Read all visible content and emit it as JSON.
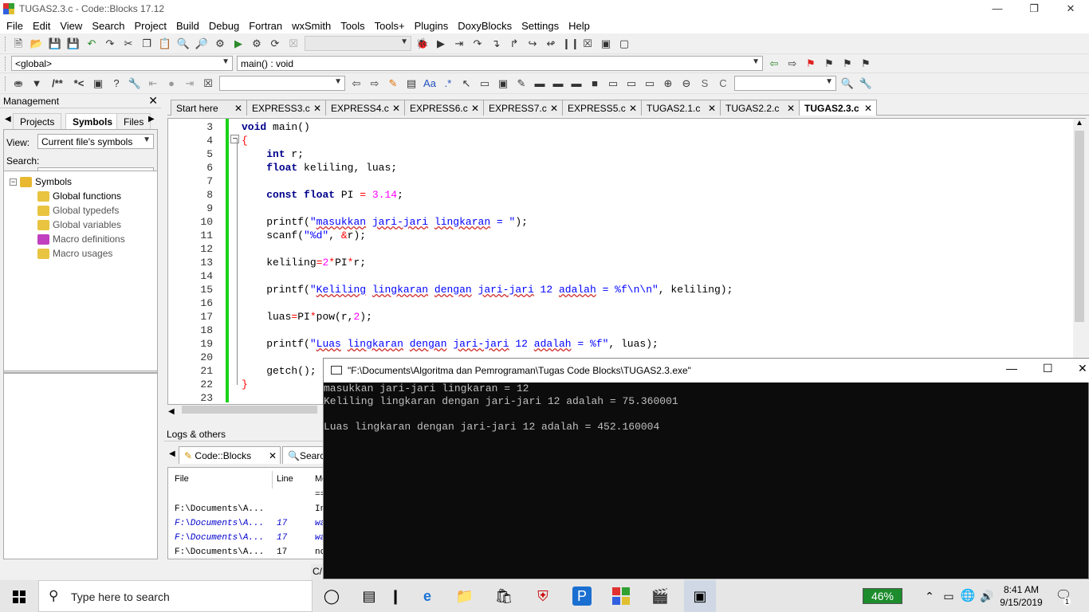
{
  "window": {
    "title": "TUGAS2.3.c - Code::Blocks 17.12"
  },
  "menu": [
    "File",
    "Edit",
    "View",
    "Search",
    "Project",
    "Build",
    "Debug",
    "Fortran",
    "wxSmith",
    "Tools",
    "Tools+",
    "Plugins",
    "DoxyBlocks",
    "Settings",
    "Help"
  ],
  "toolbar2": {
    "scope": "<global>",
    "function": "main() : void"
  },
  "toolbar3": {
    "doxy_comment": "/**",
    "doxy_line": "*<"
  },
  "management": {
    "title": "Management",
    "tabs": [
      "Projects",
      "Symbols",
      "Files"
    ],
    "view_label": "View:",
    "view_value": "Current file's symbols",
    "search_label": "Search:",
    "tree_root": "Symbols",
    "tree_items": [
      "Global functions",
      "Global typedefs",
      "Global variables",
      "Macro definitions",
      "Macro usages"
    ]
  },
  "editor_tabs": [
    "Start here",
    "EXPRESS3.c",
    "EXPRESS4.c",
    "EXPRESS6.c",
    "EXPRESS7.c",
    "EXPRESS5.c",
    "TUGAS2.1.c",
    "TUGAS2.2.c",
    "TUGAS2.3.c"
  ],
  "editor": {
    "line_numbers": [
      "3",
      "4",
      "5",
      "6",
      "7",
      "8",
      "9",
      "10",
      "11",
      "12",
      "13",
      "14",
      "15",
      "16",
      "17",
      "18",
      "19",
      "20",
      "21",
      "22",
      "23"
    ]
  },
  "logs": {
    "title": "Logs & others",
    "tabs": [
      "Code::Blocks",
      "Search"
    ],
    "headers": [
      "File",
      "Line",
      "Me"
    ],
    "rows": [
      {
        "file": "",
        "line": "",
        "msg": "=="
      },
      {
        "file": "F:\\Documents\\A...",
        "line": "",
        "msg": "In"
      },
      {
        "file": "F:\\Documents\\A...",
        "line": "17",
        "msg": "wa"
      },
      {
        "file": "F:\\Documents\\A...",
        "line": "17",
        "msg": "wa"
      },
      {
        "file": "F:\\Documents\\A...",
        "line": "17",
        "msg": "no"
      }
    ]
  },
  "console": {
    "title": "\"F:\\Documents\\Algoritma dan Pemrograman\\Tugas Code Blocks\\TUGAS2.3.exe\"",
    "lines": [
      "masukkan jari-jari lingkaran = 12",
      "Keliling lingkaran dengan jari-jari 12 adalah = 75.360001",
      "",
      "Luas lingkaran dengan jari-jari 12 adalah = 452.160004"
    ]
  },
  "status_fragment": "C/",
  "taskbar": {
    "search_placeholder": "Type here to search",
    "battery": "46%",
    "time": "8:41 AM",
    "date": "9/15/2019",
    "notification_count": "1"
  }
}
